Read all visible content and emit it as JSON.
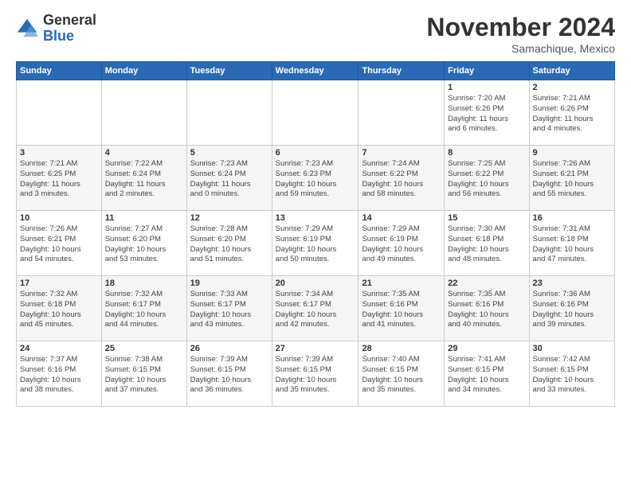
{
  "logo": {
    "general": "General",
    "blue": "Blue"
  },
  "header": {
    "month": "November 2024",
    "location": "Samachique, Mexico"
  },
  "days_of_week": [
    "Sunday",
    "Monday",
    "Tuesday",
    "Wednesday",
    "Thursday",
    "Friday",
    "Saturday"
  ],
  "weeks": [
    [
      {
        "day": "",
        "info": ""
      },
      {
        "day": "",
        "info": ""
      },
      {
        "day": "",
        "info": ""
      },
      {
        "day": "",
        "info": ""
      },
      {
        "day": "",
        "info": ""
      },
      {
        "day": "1",
        "info": "Sunrise: 7:20 AM\nSunset: 6:26 PM\nDaylight: 11 hours\nand 6 minutes."
      },
      {
        "day": "2",
        "info": "Sunrise: 7:21 AM\nSunset: 6:26 PM\nDaylight: 11 hours\nand 4 minutes."
      }
    ],
    [
      {
        "day": "3",
        "info": "Sunrise: 7:21 AM\nSunset: 6:25 PM\nDaylight: 11 hours\nand 3 minutes."
      },
      {
        "day": "4",
        "info": "Sunrise: 7:22 AM\nSunset: 6:24 PM\nDaylight: 11 hours\nand 2 minutes."
      },
      {
        "day": "5",
        "info": "Sunrise: 7:23 AM\nSunset: 6:24 PM\nDaylight: 11 hours\nand 0 minutes."
      },
      {
        "day": "6",
        "info": "Sunrise: 7:23 AM\nSunset: 6:23 PM\nDaylight: 10 hours\nand 59 minutes."
      },
      {
        "day": "7",
        "info": "Sunrise: 7:24 AM\nSunset: 6:22 PM\nDaylight: 10 hours\nand 58 minutes."
      },
      {
        "day": "8",
        "info": "Sunrise: 7:25 AM\nSunset: 6:22 PM\nDaylight: 10 hours\nand 56 minutes."
      },
      {
        "day": "9",
        "info": "Sunrise: 7:26 AM\nSunset: 6:21 PM\nDaylight: 10 hours\nand 55 minutes."
      }
    ],
    [
      {
        "day": "10",
        "info": "Sunrise: 7:26 AM\nSunset: 6:21 PM\nDaylight: 10 hours\nand 54 minutes."
      },
      {
        "day": "11",
        "info": "Sunrise: 7:27 AM\nSunset: 6:20 PM\nDaylight: 10 hours\nand 53 minutes."
      },
      {
        "day": "12",
        "info": "Sunrise: 7:28 AM\nSunset: 6:20 PM\nDaylight: 10 hours\nand 51 minutes."
      },
      {
        "day": "13",
        "info": "Sunrise: 7:29 AM\nSunset: 6:19 PM\nDaylight: 10 hours\nand 50 minutes."
      },
      {
        "day": "14",
        "info": "Sunrise: 7:29 AM\nSunset: 6:19 PM\nDaylight: 10 hours\nand 49 minutes."
      },
      {
        "day": "15",
        "info": "Sunrise: 7:30 AM\nSunset: 6:18 PM\nDaylight: 10 hours\nand 48 minutes."
      },
      {
        "day": "16",
        "info": "Sunrise: 7:31 AM\nSunset: 6:18 PM\nDaylight: 10 hours\nand 47 minutes."
      }
    ],
    [
      {
        "day": "17",
        "info": "Sunrise: 7:32 AM\nSunset: 6:18 PM\nDaylight: 10 hours\nand 45 minutes."
      },
      {
        "day": "18",
        "info": "Sunrise: 7:32 AM\nSunset: 6:17 PM\nDaylight: 10 hours\nand 44 minutes."
      },
      {
        "day": "19",
        "info": "Sunrise: 7:33 AM\nSunset: 6:17 PM\nDaylight: 10 hours\nand 43 minutes."
      },
      {
        "day": "20",
        "info": "Sunrise: 7:34 AM\nSunset: 6:17 PM\nDaylight: 10 hours\nand 42 minutes."
      },
      {
        "day": "21",
        "info": "Sunrise: 7:35 AM\nSunset: 6:16 PM\nDaylight: 10 hours\nand 41 minutes."
      },
      {
        "day": "22",
        "info": "Sunrise: 7:35 AM\nSunset: 6:16 PM\nDaylight: 10 hours\nand 40 minutes."
      },
      {
        "day": "23",
        "info": "Sunrise: 7:36 AM\nSunset: 6:16 PM\nDaylight: 10 hours\nand 39 minutes."
      }
    ],
    [
      {
        "day": "24",
        "info": "Sunrise: 7:37 AM\nSunset: 6:16 PM\nDaylight: 10 hours\nand 38 minutes."
      },
      {
        "day": "25",
        "info": "Sunrise: 7:38 AM\nSunset: 6:15 PM\nDaylight: 10 hours\nand 37 minutes."
      },
      {
        "day": "26",
        "info": "Sunrise: 7:39 AM\nSunset: 6:15 PM\nDaylight: 10 hours\nand 36 minutes."
      },
      {
        "day": "27",
        "info": "Sunrise: 7:39 AM\nSunset: 6:15 PM\nDaylight: 10 hours\nand 35 minutes."
      },
      {
        "day": "28",
        "info": "Sunrise: 7:40 AM\nSunset: 6:15 PM\nDaylight: 10 hours\nand 35 minutes."
      },
      {
        "day": "29",
        "info": "Sunrise: 7:41 AM\nSunset: 6:15 PM\nDaylight: 10 hours\nand 34 minutes."
      },
      {
        "day": "30",
        "info": "Sunrise: 7:42 AM\nSunset: 6:15 PM\nDaylight: 10 hours\nand 33 minutes."
      }
    ]
  ]
}
